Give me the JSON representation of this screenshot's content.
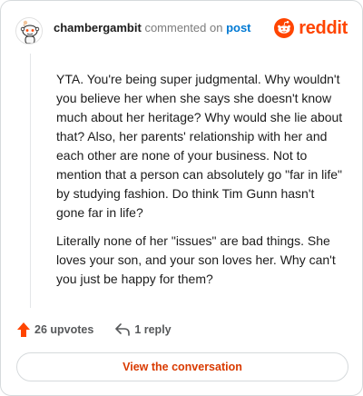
{
  "header": {
    "username": "chambergambit",
    "commented_text": "commented on",
    "post_link": "post",
    "brand_name": "reddit",
    "brand_color": "#ff4500",
    "avatar_icon": "snoo-avatar-icon"
  },
  "comment": {
    "paragraphs": [
      "YTA. You're being super judgmental. Why wouldn't you believe her when she says she doesn't know much about her heritage? Why would she lie about that? Also, her parents' relationship with her and each other are none of your business. Not to mention that a person can absolutely go \"far in life\" by studying fashion. Do think Tim Gunn hasn't gone far in life?",
      "Literally none of her \"issues\" are bad things. She loves your son, and your son loves her. Why can't you just be happy for them?"
    ]
  },
  "actions": {
    "upvotes": "26 upvotes",
    "upvote_icon": "upvote-arrow-icon",
    "upvote_color": "#ff4500",
    "replies": "1 reply",
    "reply_icon": "reply-arrow-icon"
  },
  "cta": {
    "label": "View the conversation",
    "color": "#d93a00"
  }
}
